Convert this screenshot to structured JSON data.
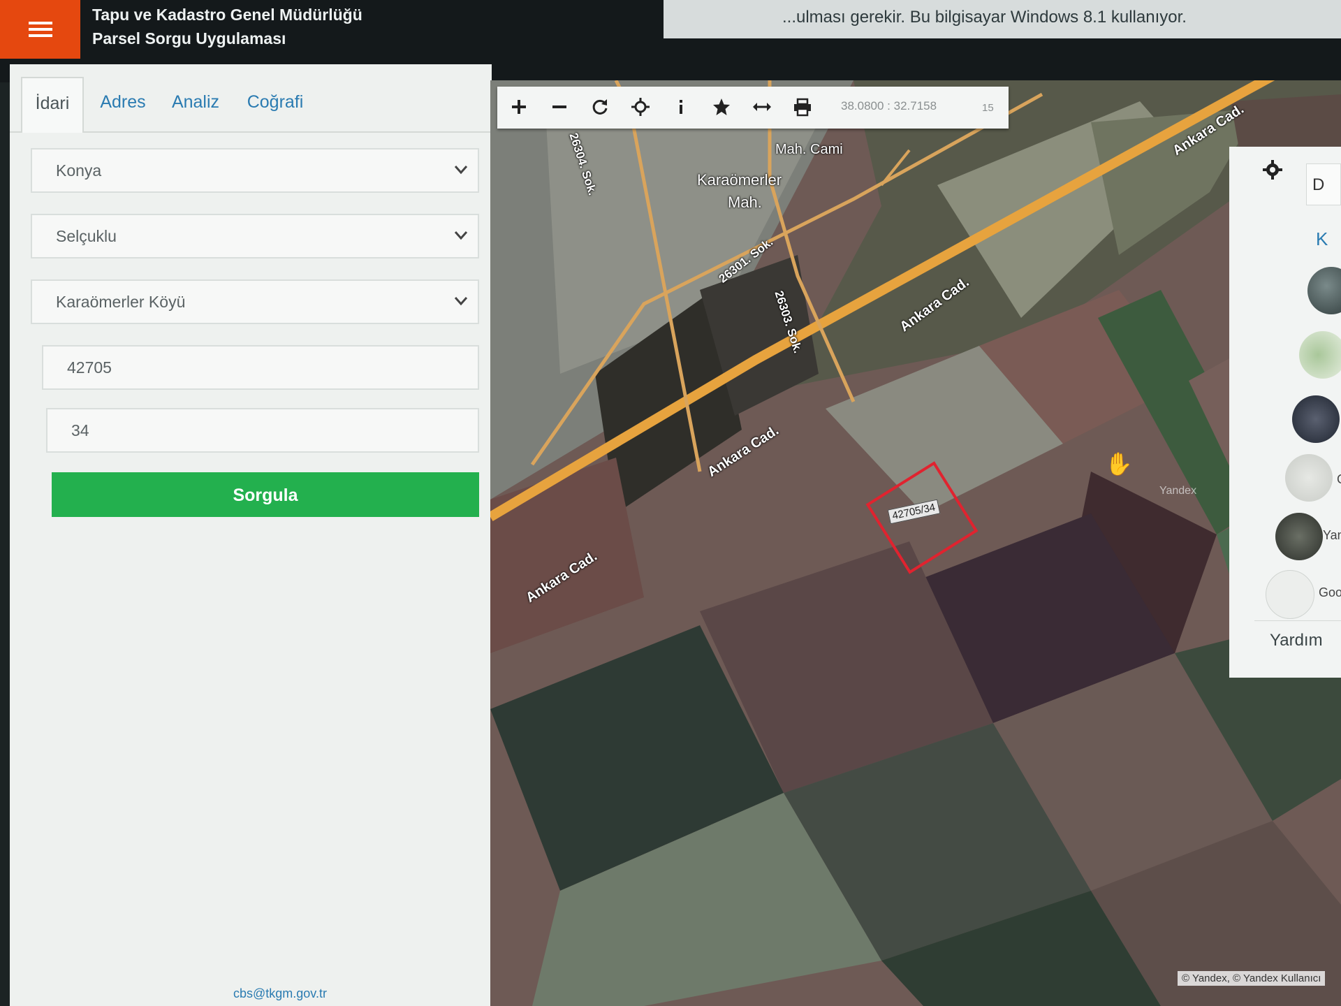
{
  "header": {
    "title_line1": "Tapu ve Kadastro Genel Müdürlüğü",
    "title_line2": "Parsel Sorgu Uygulaması",
    "banner_text": "...ulması gerekir. Bu bilgisayar Windows 8.1 kullanıyor.",
    "menu_icon": "hamburger-icon",
    "accent": "#e5480f"
  },
  "tabs": [
    {
      "label": "İdari",
      "active": true
    },
    {
      "label": "Adres",
      "active": false
    },
    {
      "label": "Analiz",
      "active": false
    },
    {
      "label": "Coğrafi",
      "active": false
    }
  ],
  "form": {
    "province": "Konya",
    "district": "Selçuklu",
    "neighborhood": "Karaömerler Köyü",
    "block": "42705",
    "parcel": "34",
    "submit_label": "Sorgula",
    "submit_color": "#23b04e"
  },
  "footer": {
    "email": "cbs@tkgm.gov.tr"
  },
  "toolbar": {
    "icons": [
      "zoom-in-icon",
      "zoom-out-icon",
      "refresh-icon",
      "locate-icon",
      "info-icon",
      "favorite-icon",
      "measure-icon",
      "print-icon"
    ],
    "coordinates": "38.0800 : 32.7158",
    "zoom_level": "15"
  },
  "map": {
    "labels": {
      "mosque": "Mah. Cami",
      "neighborhood_line1": "Karaömerler",
      "neighborhood_line2": "Mah.",
      "street_26304": "26304. Sok.",
      "street_26301": "26301. Sok.",
      "street_26303": "26303. Sok.",
      "avenue": "Ankara Cad."
    },
    "parcel_label": "42705/34",
    "parcel_color": "#e0232f",
    "watermark": "Yandex",
    "copyright": "© Yandex, © Yandex Kullanıcı"
  },
  "layers": {
    "header_text": "D",
    "tab_text": "K",
    "items": [
      {
        "label": ""
      },
      {
        "label": ""
      },
      {
        "label": ""
      },
      {
        "label": "G"
      },
      {
        "label": "Yan"
      },
      {
        "label": "Goog"
      }
    ],
    "help_label": "Yardım"
  }
}
